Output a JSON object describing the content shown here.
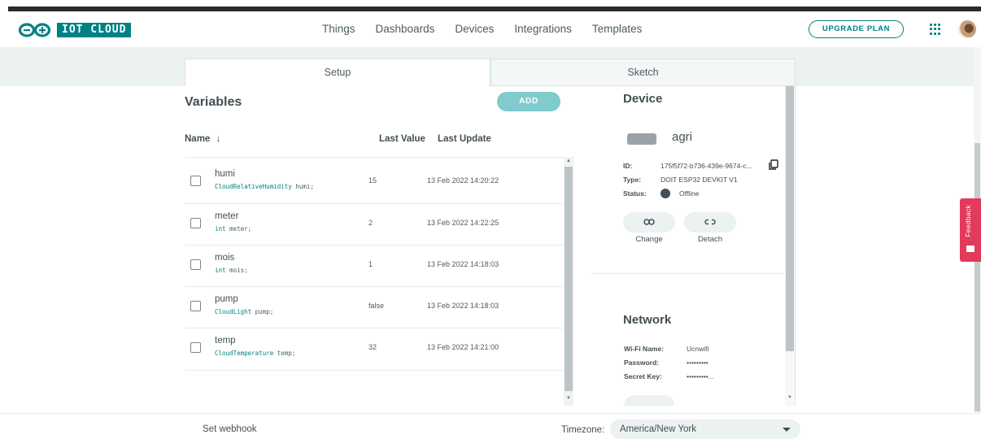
{
  "header": {
    "brand": "IOT CLOUD",
    "nav": [
      "Things",
      "Dashboards",
      "Devices",
      "Integrations",
      "Templates"
    ],
    "upgrade_label": "UPGRADE PLAN",
    "apps_icon": "grid-dots-icon",
    "avatar": "user-avatar"
  },
  "tabs": {
    "setup": "Setup",
    "sketch": "Sketch"
  },
  "variables": {
    "title": "Variables",
    "add_label": "ADD",
    "columns": {
      "name": "Name",
      "sort_arrow": "↓",
      "last_value": "Last Value",
      "last_update": "Last Update"
    },
    "rows": [
      {
        "name": "humi",
        "type": "CloudRelativeHumidity",
        "decl_var": " humi;",
        "value": "15",
        "updated": "13 Feb 2022 14:20:22"
      },
      {
        "name": "meter",
        "type": "int",
        "decl_var": " meter;",
        "value": "2",
        "updated": "13 Feb 2022 14:22:25"
      },
      {
        "name": "mois",
        "type": "int",
        "decl_var": " mois;",
        "value": "1",
        "updated": "13 Feb 2022 14:18:03"
      },
      {
        "name": "pump",
        "type": "CloudLight",
        "decl_var": " pump;",
        "value": "false",
        "updated": "13 Feb 2022 14:18:03"
      },
      {
        "name": "temp",
        "type": "CloudTemperature",
        "decl_var": " temp;",
        "value": "32",
        "updated": "13 Feb 2022 14:21:00"
      }
    ]
  },
  "device": {
    "title": "Device",
    "name": "agri",
    "id_label": "ID:",
    "id_value": "175f5f72-b736-439e-9674-c...",
    "type_label": "Type:",
    "type_value": "DOIT ESP32 DEVKIT V1",
    "status_label": "Status:",
    "status_value": "Offline",
    "change_label": "Change",
    "detach_label": "Detach"
  },
  "network": {
    "title": "Network",
    "wifi_label": "Wi-Fi Name:",
    "wifi_value": "Ucnwifi",
    "password_label": "Password:",
    "password_value": "•••••••••",
    "secret_label": "Secret Key:",
    "secret_value": "•••••••••..."
  },
  "feedback_label": "Feedback",
  "footer": {
    "webhook": "Set webhook",
    "timezone_label": "Timezone:",
    "timezone_value": "America/New York"
  },
  "colors": {
    "brand": "#008184",
    "accent_light": "#7fcbcd",
    "feedback": "#e3395a"
  }
}
